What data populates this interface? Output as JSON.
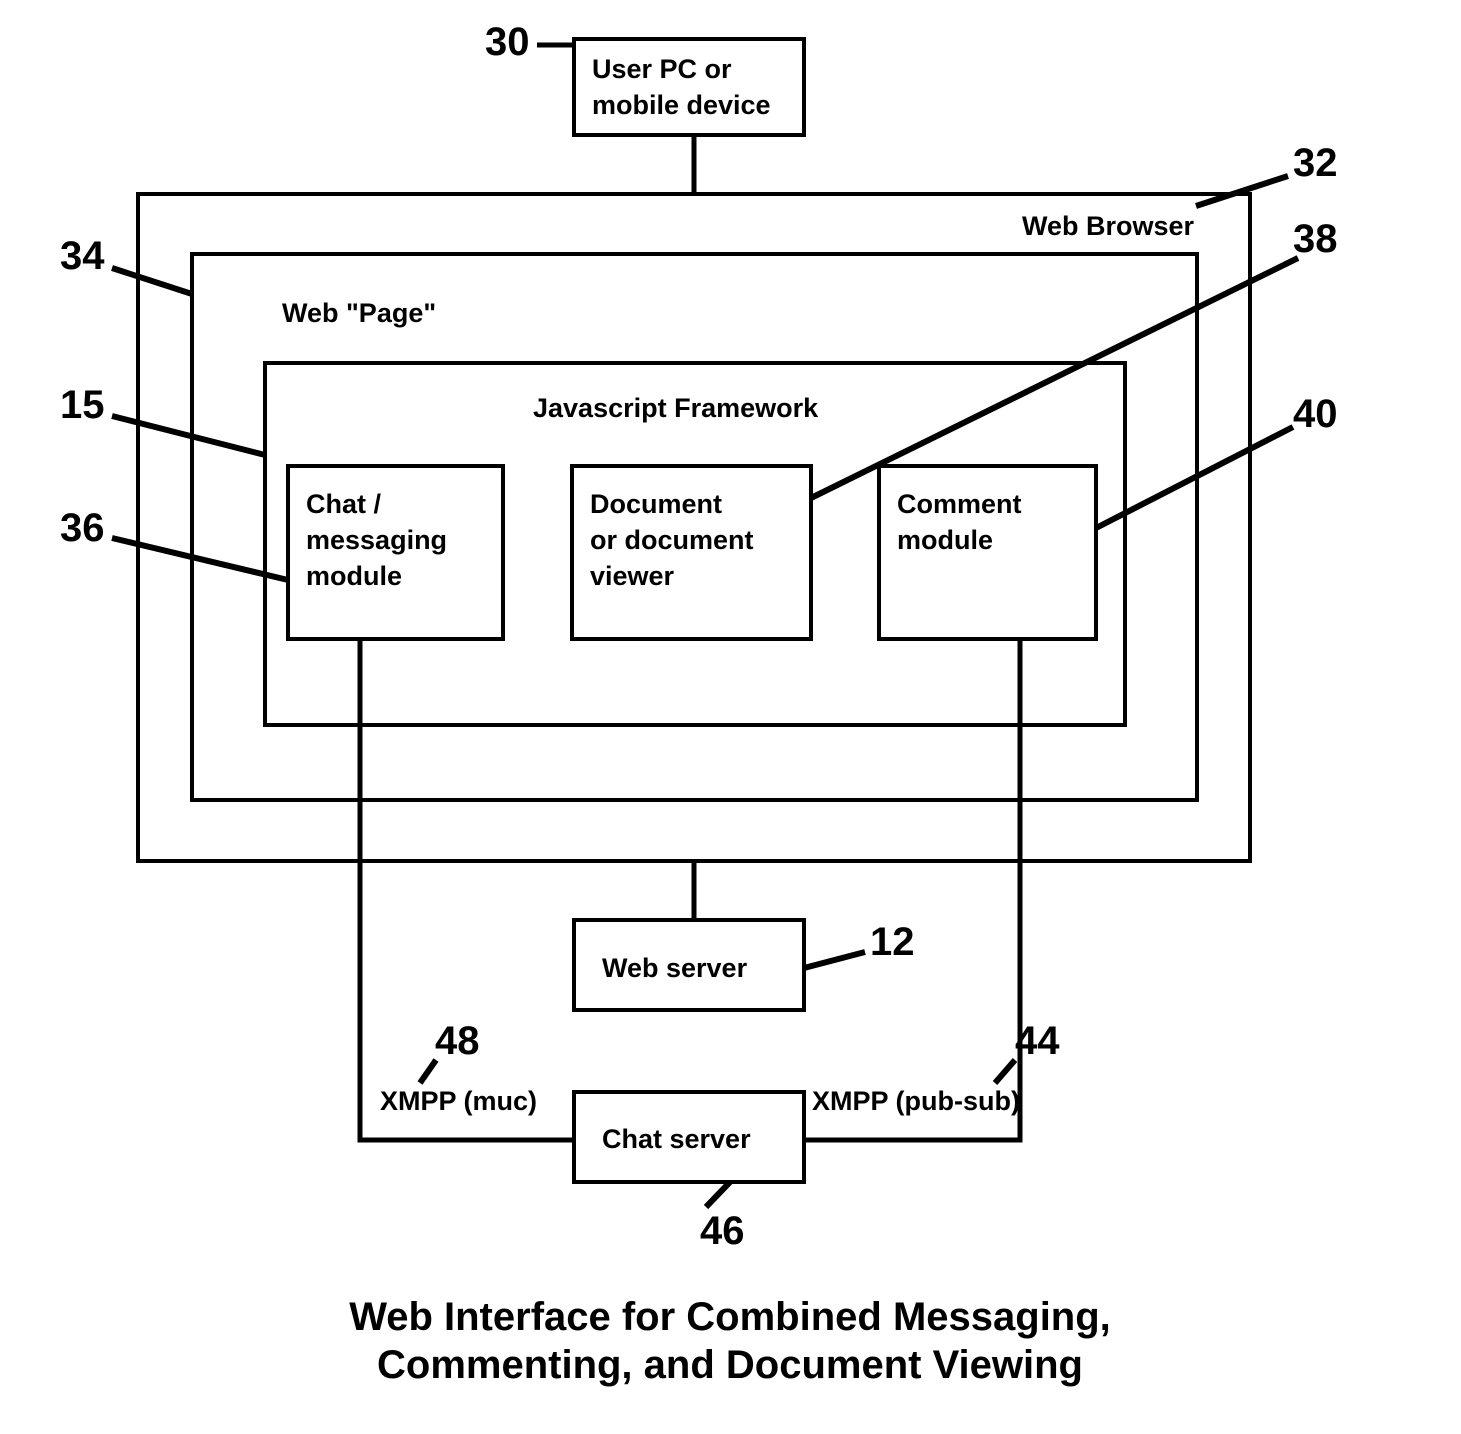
{
  "title": {
    "line1": "Web Interface for Combined Messaging,",
    "line2": "Commenting, and Document Viewing"
  },
  "labels": {
    "user_pc_l1": "User PC or",
    "user_pc_l2": "mobile device",
    "web_browser": "Web Browser",
    "web_page": "Web \"Page\"",
    "js_framework": "Javascript Framework",
    "chat_mod_l1": "Chat /",
    "chat_mod_l2": "messaging",
    "chat_mod_l3": "module",
    "doc_viewer_l1": "Document",
    "doc_viewer_l2": "or document",
    "doc_viewer_l3": "viewer",
    "comment_mod_l1": "Comment",
    "comment_mod_l2": "module",
    "web_server": "Web server",
    "chat_server": "Chat server",
    "xmpp_muc": "XMPP (muc)",
    "xmpp_pubsub": "XMPP (pub-sub)"
  },
  "refs": {
    "n30": "30",
    "n32": "32",
    "n34": "34",
    "n38": "38",
    "n15": "15",
    "n40": "40",
    "n36": "36",
    "n12": "12",
    "n48": "48",
    "n44": "44",
    "n46": "46"
  }
}
